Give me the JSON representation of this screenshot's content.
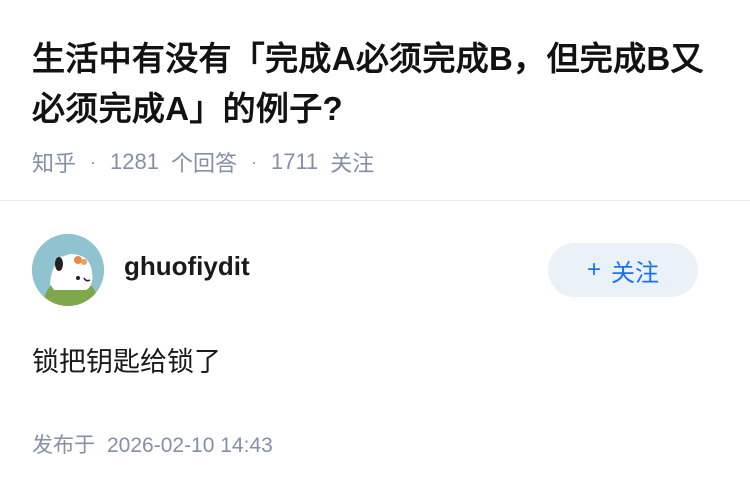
{
  "question": {
    "title": "生活中有没有「完成A必须完成B，但完成B又必须完成A」的例子?",
    "source": "知乎",
    "answer_count": "1281",
    "answer_label": "个回答",
    "follower_count": "1711",
    "follower_label": "关注"
  },
  "answer": {
    "author_name": "ghuofiydit",
    "follow_button": "关注",
    "content": "锁把钥匙给锁了",
    "publish_label": "发布于",
    "publish_time": "2026-02-10 14:43"
  },
  "colors": {
    "meta": "#8590a6",
    "accent": "#1772f6",
    "button_bg": "#ebf1f9"
  }
}
